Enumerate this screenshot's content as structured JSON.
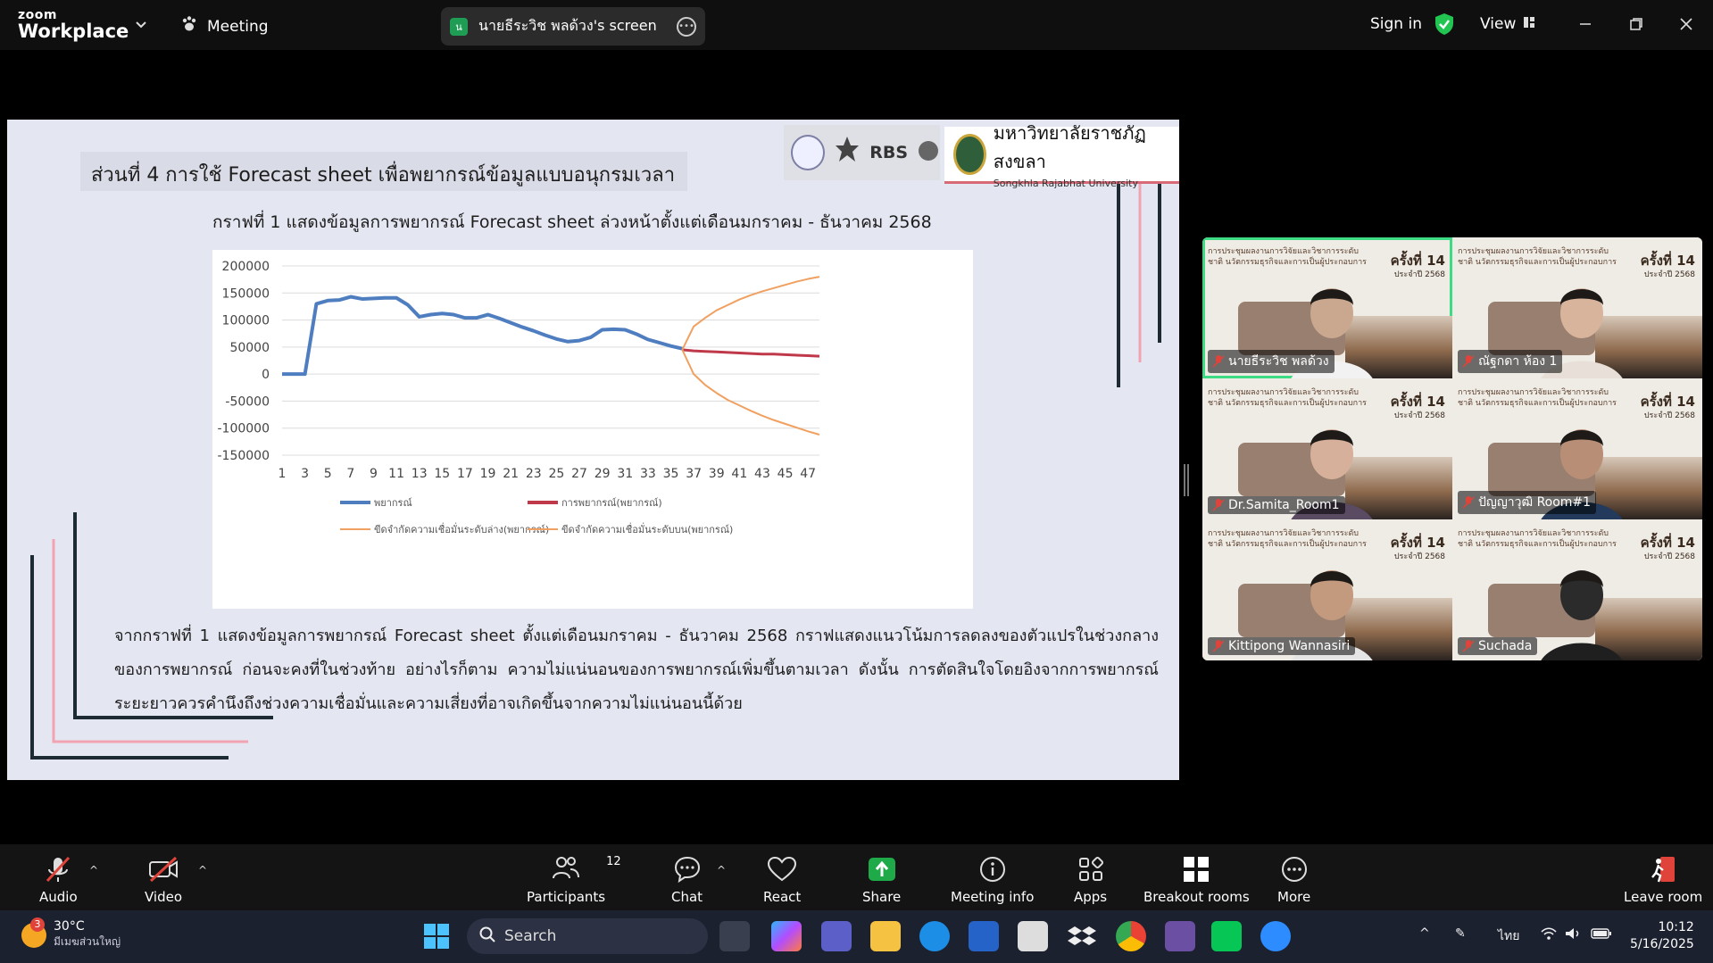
{
  "titlebar": {
    "logo_line1": "zoom",
    "logo_line2": "Workplace",
    "meeting_label": "Meeting",
    "share_badge": "น",
    "share_label": "นายธีระวิช พลด้วง's screen",
    "sign_in": "Sign in",
    "view": "View"
  },
  "slide": {
    "section_title": "ส่วนที่ 4 การใช้ Forecast sheet เพื่อพยากรณ์ข้อมูลแบบอนุกรมเวลา",
    "rbs": "RBS",
    "university_thai": "มหาวิทยาลัยราชภัฏสงขลา",
    "university_en": "Songkhla Rajabhat University",
    "chart_caption": "กราฟที่ 1 แสดงข้อมูลการพยากรณ์ Forecast sheet ล่วงหน้าตั้งแต่เดือนมกราคม - ธันวาคม 2568",
    "description": "จากกราฟที่ 1 แสดงข้อมูลการพยากรณ์ Forecast sheet ตั้งแต่เดือนมกราคม - ธันวาคม 2568 กราฟแสดงแนวโน้มการลดลงของตัวแปรในช่วงกลางของการพยากรณ์ ก่อนจะคงที่ในช่วงท้าย อย่างไรก็ตาม ความไม่แน่นอนของการพยากรณ์เพิ่มขึ้นตามเวลา ดังนั้น การตัดสินใจโดยอิงจากการพยากรณ์ระยะยาวควรคำนึงถึงช่วงความเชื่อมั่นและความเสี่ยงที่อาจเกิดขึ้นจากความไม่แน่นอนนี้ด้วย"
  },
  "chart_data": {
    "type": "line",
    "ylim": [
      -150000,
      200000
    ],
    "yticks": [
      "200000",
      "150000",
      "100000",
      "50000",
      "0",
      "-50000",
      "-100000",
      "-150000"
    ],
    "xticks": [
      "1",
      "3",
      "5",
      "7",
      "9",
      "11",
      "13",
      "15",
      "17",
      "19",
      "21",
      "23",
      "25",
      "27",
      "29",
      "31",
      "33",
      "35",
      "37",
      "39",
      "41",
      "43",
      "45",
      "47"
    ],
    "legend_position": "bottom",
    "series": [
      {
        "name": "พยากรณ์",
        "color": "#4f7ec0",
        "x": [
          1,
          2,
          3,
          4,
          5,
          6,
          7,
          8,
          9,
          10,
          11,
          12,
          13,
          14,
          15,
          16,
          17,
          18,
          19,
          20,
          21,
          22,
          23,
          24,
          25,
          26,
          27,
          28,
          29,
          30,
          31,
          32,
          33,
          34,
          35,
          36
        ],
        "y": [
          0,
          0,
          0,
          130000,
          136000,
          137000,
          143000,
          139000,
          140000,
          141000,
          141000,
          128000,
          106000,
          110000,
          112000,
          110000,
          104000,
          104000,
          110000,
          103000,
          95000,
          87000,
          80000,
          72000,
          65000,
          60000,
          62000,
          68000,
          82000,
          83000,
          82000,
          74000,
          64000,
          58000,
          52000,
          47000
        ]
      },
      {
        "name": "การพยากรณ์(พยากรณ์)",
        "color": "#c0394b",
        "x": [
          36,
          37,
          38,
          39,
          40,
          41,
          42,
          43,
          44,
          45,
          46,
          47,
          48
        ],
        "y": [
          45000,
          43000,
          42000,
          41000,
          40000,
          39000,
          38000,
          37000,
          37000,
          36000,
          35000,
          34000,
          33000
        ]
      },
      {
        "name": "ขีดจำกัดความเชื่อมั่นระดับล่าง(พยากรณ์)",
        "color": "#f0a060",
        "x": [
          36,
          37,
          38,
          39,
          40,
          41,
          42,
          43,
          44,
          45,
          46,
          47,
          48
        ],
        "y": [
          45000,
          0,
          -20000,
          -35000,
          -48000,
          -58000,
          -68000,
          -77000,
          -85000,
          -92000,
          -99000,
          -106000,
          -112000
        ]
      },
      {
        "name": "ขีดจำกัดความเชื่อมั่นระดับบน(พยากรณ์)",
        "color": "#f0a060",
        "x": [
          36,
          37,
          38,
          39,
          40,
          41,
          42,
          43,
          44,
          45,
          46,
          47,
          48
        ],
        "y": [
          45000,
          88000,
          104000,
          118000,
          128000,
          138000,
          146000,
          153000,
          159000,
          165000,
          171000,
          176000,
          180000
        ]
      }
    ]
  },
  "gallery": {
    "bg_text": "การประชุมผลงานการวิจัยและวิชาการระดับชาติ นวัตกรรมธุรกิจและการเป็นผู้ประกอบการ",
    "round": "ครั้งที่ 14",
    "round_sub": "ประจำปี 2568",
    "participants": [
      {
        "name": "นายธีระวิช พลด้วง"
      },
      {
        "name": "ณัฐกดา ห้อง 1"
      },
      {
        "name": "Dr.Samita_Room1"
      },
      {
        "name": "ปัญญาวุฒิ Room#1"
      },
      {
        "name": "Kittipong Wannasiri"
      },
      {
        "name": "Suchada"
      }
    ]
  },
  "toolbar": {
    "audio": "Audio",
    "video": "Video",
    "participants": "Participants",
    "participants_count": "12",
    "chat": "Chat",
    "react": "React",
    "share": "Share",
    "meeting_info": "Meeting info",
    "apps": "Apps",
    "breakout": "Breakout rooms",
    "more": "More",
    "leave": "Leave room"
  },
  "taskbar": {
    "weather_badge": "3",
    "temp": "30°C",
    "weather_desc": "มีเมฆส่วนใหญ่",
    "search": "Search",
    "lang": "ไทย",
    "time": "10:12",
    "date": "5/16/2025"
  },
  "colors": {
    "accent_green": "#3ddc84",
    "share_green": "#1faa4a",
    "leave_red": "#e0433a"
  }
}
